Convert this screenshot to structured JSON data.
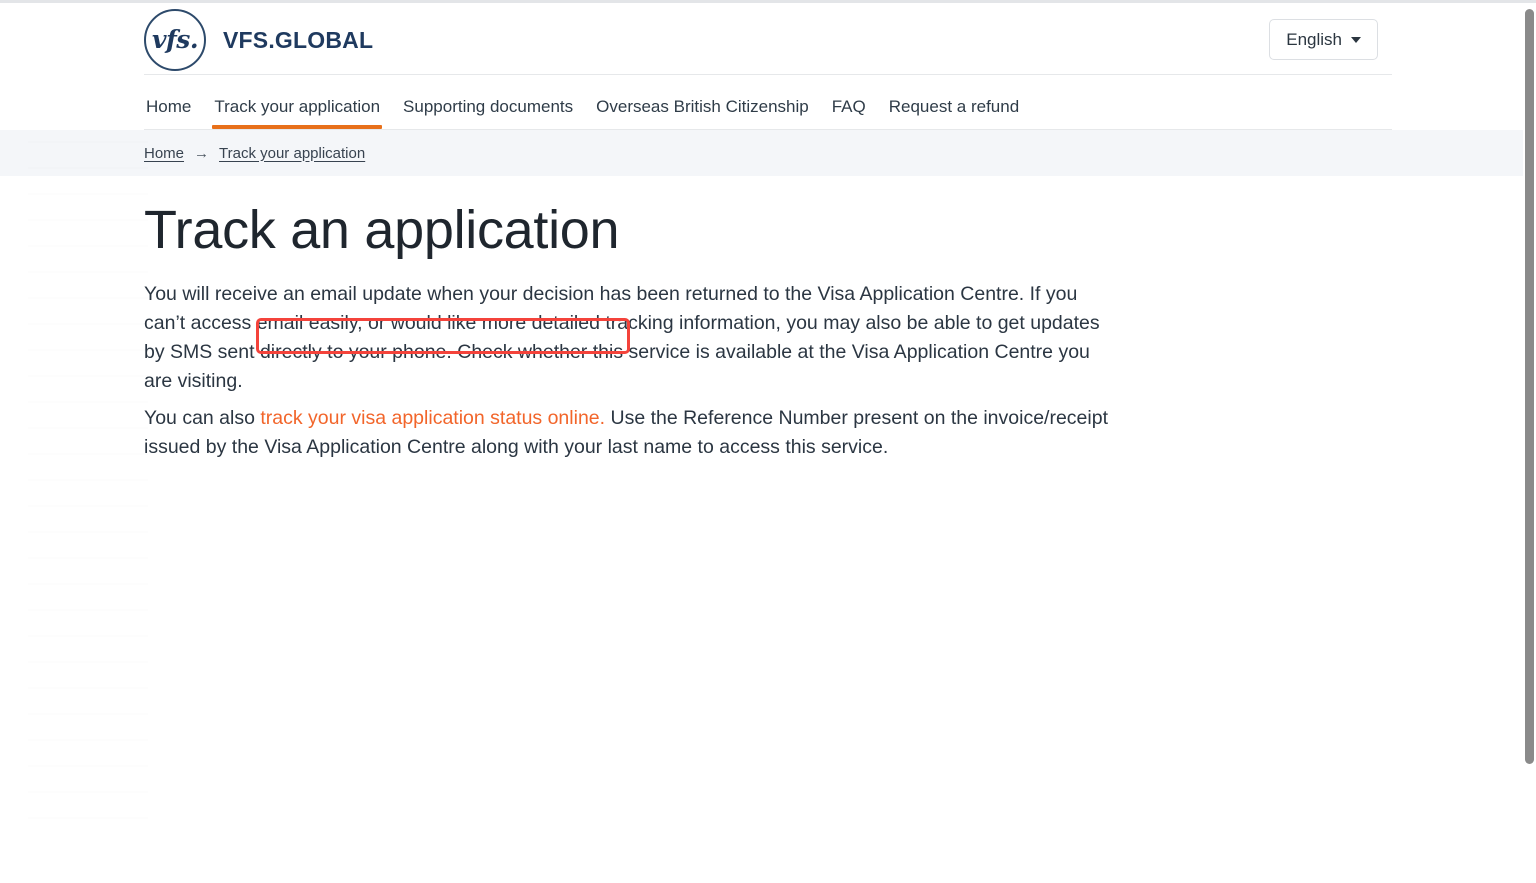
{
  "header": {
    "brand_mark_text": "vfs.",
    "brand_name": "VFS.GLOBAL",
    "language_label": "English"
  },
  "nav": {
    "items": [
      {
        "label": "Home",
        "active": false
      },
      {
        "label": "Track your application",
        "active": true
      },
      {
        "label": "Supporting documents",
        "active": false
      },
      {
        "label": "Overseas British Citizenship",
        "active": false
      },
      {
        "label": "FAQ",
        "active": false
      },
      {
        "label": "Request a refund",
        "active": false
      }
    ]
  },
  "breadcrumb": {
    "home_label": "Home",
    "separator": "→",
    "current_label": "Track your application"
  },
  "main": {
    "title": "Track an application",
    "paragraph_1": "You will receive an email update when your decision has been returned to the Visa Application Centre. If you can’t access email easily, or would like more detailed tracking information, you may also be able to get updates by SMS sent directly to your phone. Check whether this service is available at the Visa Application Centre you are visiting.",
    "paragraph_2_prefix": "You can also ",
    "paragraph_2_link": "track your visa application status online.",
    "paragraph_2_suffix": " Use the Reference Number present on the invoice/receipt issued by the Visa Application Centre along with your last name to access this service."
  },
  "colors": {
    "brand_navy": "#1f3a5f",
    "accent_orange": "#e8701a",
    "link_orange": "#f2652a",
    "annotation_red": "#f4433b",
    "breadcrumb_bg": "#f4f6f9",
    "rule_gray": "#e6e8ea"
  }
}
